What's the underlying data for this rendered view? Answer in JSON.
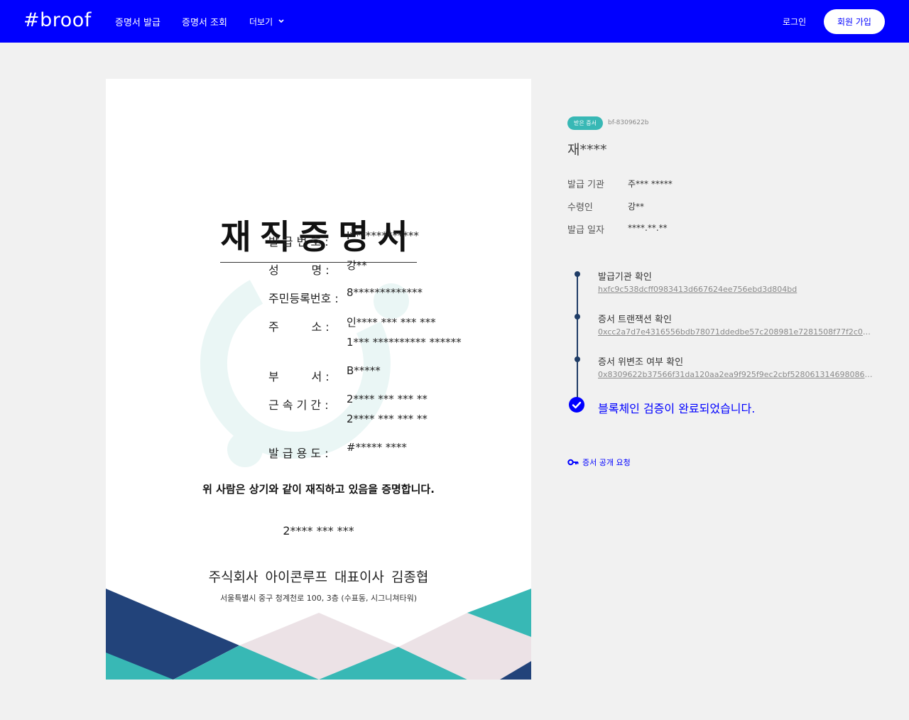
{
  "header": {
    "logo": "#broof",
    "nav": [
      "증명서 발급",
      "증명서 조회",
      "더보기"
    ],
    "login": "로그인",
    "signup": "회원 가입"
  },
  "certificate": {
    "title": "재직증명서",
    "fields": [
      {
        "label": "발 급 번 호 :",
        "values": [
          "I*************"
        ]
      },
      {
        "label": "성         명 :",
        "values": [
          "강**"
        ]
      },
      {
        "label": "주민등록번호 :",
        "values": [
          "8*************"
        ]
      },
      {
        "label": "주         소 :",
        "values": [
          "인**** *** *** ***",
          "1*** ********** ******"
        ]
      },
      {
        "label": "부         서 :",
        "values": [
          "B*****"
        ]
      },
      {
        "label": "근 속 기 간 :",
        "values": [
          "2**** *** *** **",
          "2**** *** *** **"
        ]
      },
      {
        "label": "발 급 용 도 :",
        "values": [
          "#***** ****"
        ]
      }
    ],
    "statement": "위 사람은 상기와 같이 재직하고 있음을 증명합니다.",
    "date": "2**** *** ***",
    "company": "주식회사 아이콘루프  대표이사 김종협",
    "address": "서울특별시 중구 청계천로 100, 3층 (수표동, 시그니쳐타워)"
  },
  "panel": {
    "badge": "받은 증서",
    "cert_id": "bf-8309622b",
    "doc_title": "재****",
    "info": [
      {
        "label": "발급 기관",
        "value": "주*** *****"
      },
      {
        "label": "수령인",
        "value": "강**"
      },
      {
        "label": "발급 일자",
        "value": "****.**.**"
      }
    ],
    "steps": [
      {
        "title": "발급기관 확인",
        "hash": "hxfc9c538dcff0983413d667624ee756ebd3d804bd"
      },
      {
        "title": "증서 트랜잭션 확인",
        "hash": "0xcc2a7d7e4316556bdb78071ddedbe57c208981e7281508f77f2c02d..."
      },
      {
        "title": "증서 위변조 여부 확인",
        "hash": "0x8309622b37566f31da120aa2ea9f925f9ec2cbf528061314698086e5..."
      }
    ],
    "verified": "블록체인 검증이 완료되었습니다.",
    "reveal_request": "증서 공개 요청"
  },
  "colors": {
    "brand": "#0000ff",
    "teal": "#38b8b5",
    "navy": "#22437a",
    "pink": "#ece2e6"
  }
}
